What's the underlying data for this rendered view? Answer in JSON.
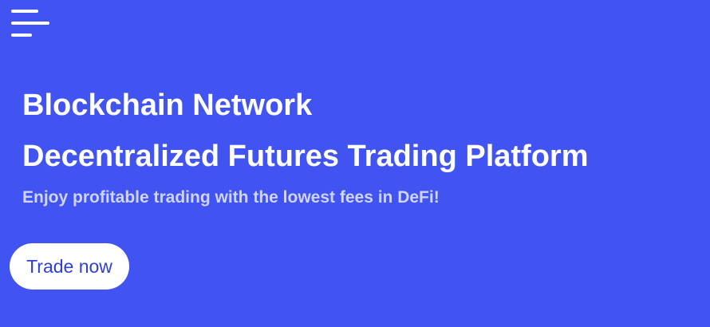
{
  "header": {
    "menu_icon": "hamburger-menu-icon"
  },
  "hero": {
    "title_line1": "Blockchain Network",
    "title_line2": "Decentralized Futures Trading Platform",
    "subtitle": "Enjoy profitable trading with the lowest fees in DeFi!",
    "cta_label": "Trade now"
  },
  "colors": {
    "background": "#4154f1",
    "title_text": "#ffffff",
    "subtitle_text": "#cfd5ff",
    "button_background": "#ffffff",
    "button_text": "#2f3fd6"
  }
}
